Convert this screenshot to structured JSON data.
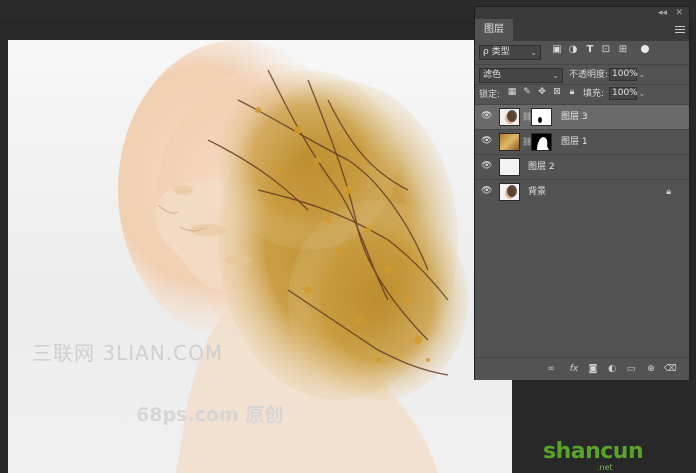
{
  "panel": {
    "tab_label": "图层",
    "collapse_glyph": "◂◂",
    "close_glyph": "✕"
  },
  "filter": {
    "kind_label": "类型",
    "search_glyph": "ρ",
    "icons": [
      "image-filter-icon",
      "adjustment-filter-icon",
      "type-filter-icon",
      "shape-filter-icon",
      "smart-object-filter-icon"
    ]
  },
  "blend": {
    "mode": "滤色",
    "opacity_label": "不透明度:",
    "opacity_value": "100%"
  },
  "lock": {
    "label": "锁定:",
    "fill_label": "填充:",
    "fill_value": "100%"
  },
  "layers": [
    {
      "name": "图层 3",
      "selected": true,
      "has_mask": true,
      "locked": false
    },
    {
      "name": "图层 1",
      "selected": false,
      "has_mask": true,
      "locked": false
    },
    {
      "name": "图层 2",
      "selected": false,
      "has_mask": false,
      "locked": false
    },
    {
      "name": "背景",
      "selected": false,
      "has_mask": false,
      "locked": true
    }
  ],
  "footer_icons": [
    "link-layers-icon",
    "fx-icon",
    "add-mask-icon",
    "adjustment-layer-icon",
    "new-group-icon",
    "new-layer-icon",
    "delete-layer-icon"
  ],
  "watermarks": {
    "line1": "三联网 3LIAN.COM",
    "line2": "68ps.com 原创"
  },
  "brand": {
    "text": "shancun",
    "sub": ".net"
  },
  "colors": {
    "workspace_bg": "#282828",
    "panel_bg": "#535353",
    "selected_layer": "#6a6a6a",
    "brand_green": "#59a32a"
  }
}
